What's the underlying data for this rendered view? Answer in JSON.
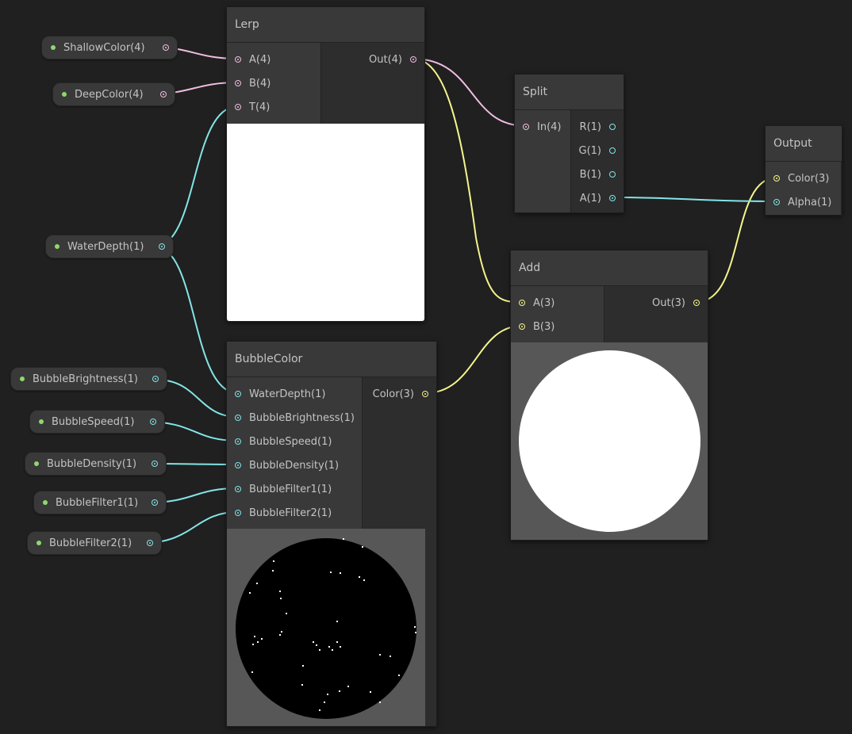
{
  "properties": [
    {
      "label": "ShallowColor(4)",
      "port": "pink"
    },
    {
      "label": "DeepColor(4)",
      "port": "pink"
    },
    {
      "label": "WaterDepth(1)",
      "port": "cyan"
    },
    {
      "label": "BubbleBrightness(1)",
      "port": "cyan"
    },
    {
      "label": "BubbleSpeed(1)",
      "port": "cyan"
    },
    {
      "label": "BubbleDensity(1)",
      "port": "cyan"
    },
    {
      "label": "BubbleFilter1(1)",
      "port": "cyan"
    },
    {
      "label": "BubbleFilter2(1)",
      "port": "cyan"
    }
  ],
  "nodes": {
    "lerp": {
      "title": "Lerp",
      "inputs": [
        "A(4)",
        "B(4)",
        "T(4)"
      ],
      "outputs": [
        "Out(4)"
      ]
    },
    "split": {
      "title": "Split",
      "inputs": [
        "In(4)"
      ],
      "outputs": [
        "R(1)",
        "G(1)",
        "B(1)",
        "A(1)"
      ]
    },
    "output": {
      "title": "Output",
      "inputs": [
        "Color(3)",
        "Alpha(1)"
      ]
    },
    "add": {
      "title": "Add",
      "inputs": [
        "A(3)",
        "B(3)"
      ],
      "outputs": [
        "Out(3)"
      ]
    },
    "bubble": {
      "title": "BubbleColor",
      "inputs": [
        "WaterDepth(1)",
        "BubbleBrightness(1)",
        "BubbleSpeed(1)",
        "BubbleDensity(1)",
        "BubbleFilter1(1)",
        "BubbleFilter2(1)"
      ],
      "outputs": [
        "Color(3)"
      ]
    }
  },
  "colors": {
    "pink": "#f0bde0",
    "cyan": "#84e4e7",
    "yellow": "#f5f58c",
    "property_dot": "#8fd870"
  }
}
